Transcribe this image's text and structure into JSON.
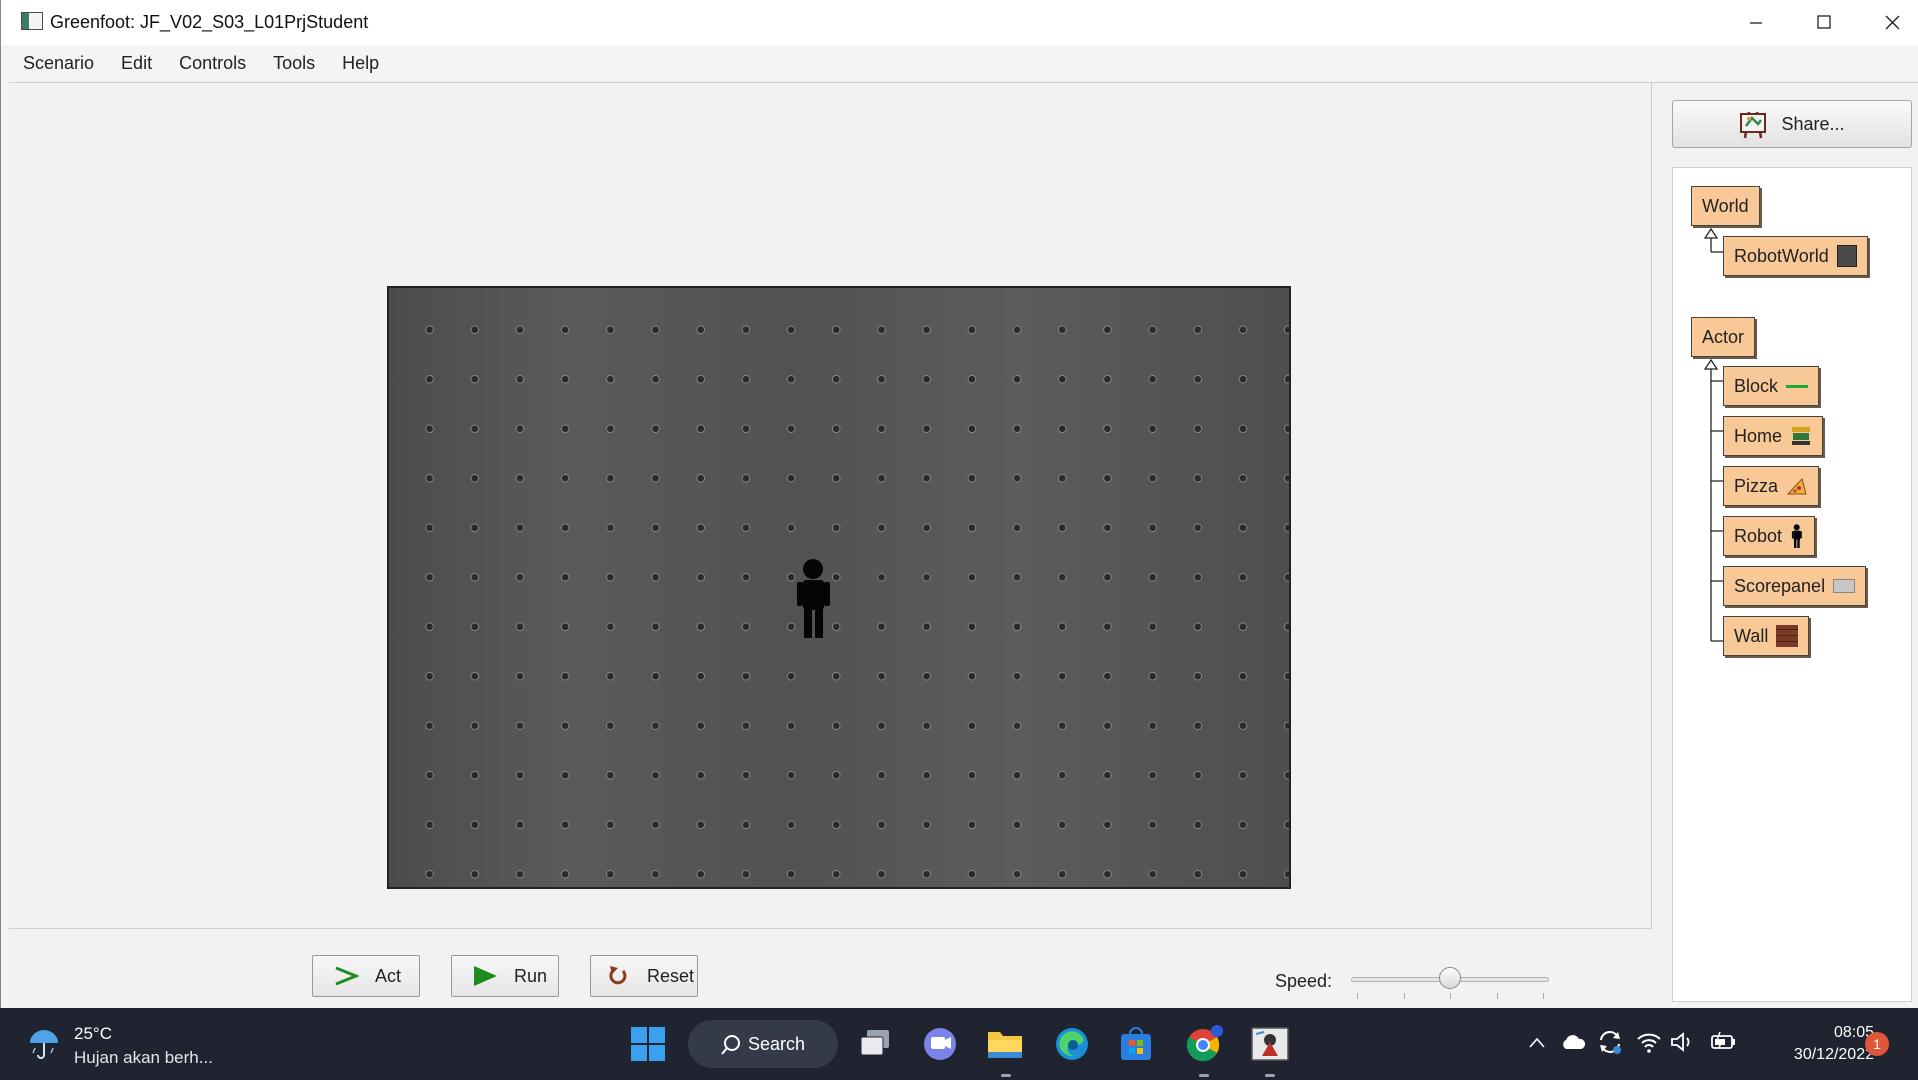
{
  "window": {
    "title": "Greenfoot: JF_V02_S03_L01PrjStudent",
    "controls": [
      "minimize",
      "maximize",
      "close"
    ]
  },
  "menu": {
    "items": [
      "Scenario",
      "Edit",
      "Controls",
      "Tools",
      "Help"
    ]
  },
  "world": {
    "name": "RobotWorld",
    "background": "metal-plate-riveted",
    "actors": [
      {
        "class": "Robot",
        "icon": "person-icon"
      }
    ]
  },
  "controls": {
    "act_label": "Act",
    "run_label": "Run",
    "reset_label": "Reset",
    "speed_label": "Speed:",
    "speed_value": 0.5
  },
  "sidebar": {
    "share_label": "Share...",
    "class_tree": {
      "world_root": "World",
      "world_subclasses": [
        "RobotWorld"
      ],
      "actor_root": "Actor",
      "actor_subclasses": [
        "Block",
        "Home",
        "Pizza",
        "Robot",
        "Scorepanel",
        "Wall"
      ]
    }
  },
  "taskbar": {
    "weather_temp": "25°C",
    "weather_desc": "Hujan akan berh...",
    "search_label": "Search",
    "time": "08:05",
    "date": "30/12/2022",
    "notification_count": "1"
  },
  "colors": {
    "class_box": "#f8c896",
    "run_green": "#1f8a1f",
    "reset_brown": "#8a3a1a",
    "taskbar_bg": "#1f2430"
  }
}
